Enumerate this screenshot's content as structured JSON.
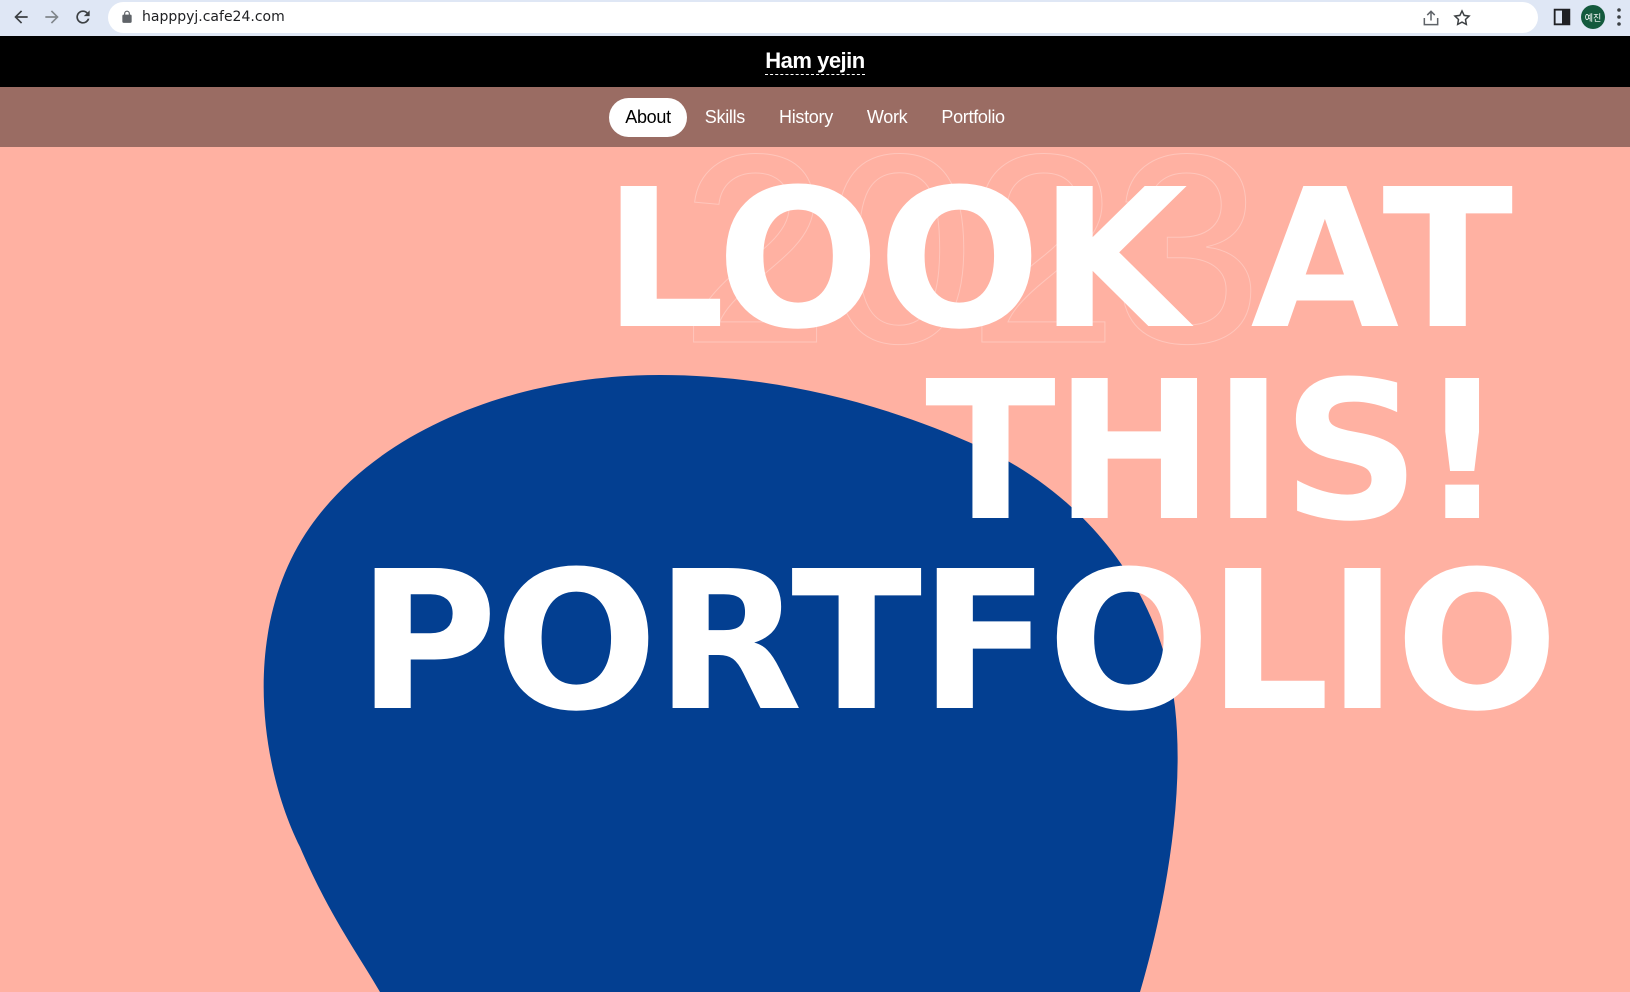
{
  "browser": {
    "url": "happpyj.cafe24.com",
    "profile_initials": "예진",
    "icons": [
      "back-icon",
      "forward-icon",
      "reload-icon",
      "lock-icon",
      "share-icon",
      "star-icon",
      "side-panel-icon",
      "menu-icon"
    ]
  },
  "site": {
    "title": "Ham yejin",
    "nav": [
      {
        "label": "About",
        "active": true
      },
      {
        "label": "Skills",
        "active": false
      },
      {
        "label": "History",
        "active": false
      },
      {
        "label": "Work",
        "active": false
      },
      {
        "label": "Portfolio",
        "active": false
      }
    ]
  },
  "hero": {
    "line1": "LOOK AT",
    "line2": "THIS!",
    "line3": "PORTFOLIO",
    "background_year": "2023"
  },
  "colors": {
    "header_bg": "#000000",
    "nav_bg": "#9a6c63",
    "hero_bg": "#ffb1a2",
    "blob": "#033f91",
    "text": "#ffffff"
  }
}
